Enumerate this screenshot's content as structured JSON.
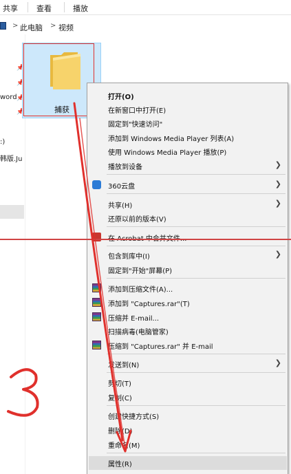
{
  "ribbon": {
    "tabs": [
      "共享",
      "查看",
      "播放"
    ]
  },
  "address": {
    "crumbs": [
      "此电脑",
      "视频"
    ],
    "separator": ">"
  },
  "nav": {
    "items": [
      {
        "label": ""
      },
      {
        "label": ""
      },
      {
        "label": "word"
      },
      {
        "label": ""
      },
      {
        "label": ":)"
      },
      {
        "label": "韩版.Ju"
      }
    ]
  },
  "folder": {
    "name": "捕获",
    "icon": "folder-icon"
  },
  "annotation": {
    "number": "3",
    "color": "#e0302c"
  },
  "menu": {
    "items": [
      {
        "label": "打开(O)",
        "bold": true
      },
      {
        "label": "在新窗口中打开(E)"
      },
      {
        "label": "固定到\"快速访问\""
      },
      {
        "label": "添加到 Windows Media Player 列表(A)"
      },
      {
        "label": "使用 Windows Media Player 播放(P)"
      },
      {
        "label": "播放到设备",
        "submenu": true
      },
      {
        "label": "360云盘",
        "submenu": true,
        "icon": "cloud-icon"
      },
      {
        "label": "共享(H)",
        "submenu": true
      },
      {
        "label": "还原以前的版本(V)"
      },
      {
        "label": "在 Acrobat 中合并文件..."
      },
      {
        "label": "包含到库中(I)",
        "submenu": true
      },
      {
        "label": "固定到\"开始\"屏幕(P)"
      },
      {
        "label": "添加到压缩文件(A)...",
        "icon": "winrar-icon"
      },
      {
        "label": "添加到 \"Captures.rar\"(T)",
        "icon": "winrar-icon"
      },
      {
        "label": "压缩并 E-mail...",
        "icon": "winrar-icon"
      },
      {
        "label": "扫描病毒(电脑管家)"
      },
      {
        "label": "压缩到 \"Captures.rar\" 并 E-mail",
        "icon": "winrar-icon"
      },
      {
        "label": "发送到(N)",
        "submenu": true
      },
      {
        "label": "剪切(T)"
      },
      {
        "label": "复制(C)"
      },
      {
        "label": "创建快捷方式(S)"
      },
      {
        "label": "删除(D)"
      },
      {
        "label": "重命名(M)"
      },
      {
        "label": "属性(R)"
      }
    ]
  }
}
